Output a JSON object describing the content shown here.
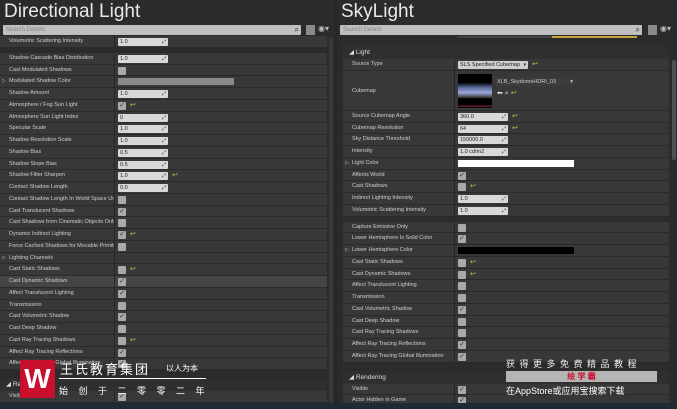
{
  "left": {
    "title": "Directional Light",
    "search_placeholder": "Search Details",
    "rows": [
      {
        "label": "Volumetric Scattering Intensity",
        "type": "number",
        "value": "1.0"
      },
      {
        "type": "gap"
      },
      {
        "label": "Shadow Cascade Bias Distribution",
        "type": "number",
        "value": "1.0"
      },
      {
        "label": "Cast Modulated Shadows",
        "type": "check",
        "checked": false
      },
      {
        "label": "Modulated Shadow Color",
        "type": "bar",
        "expand": true,
        "color": "#8a8a8a"
      },
      {
        "label": "Shadow Amount",
        "type": "number",
        "value": "1.0"
      },
      {
        "label": "Atmosphere / Fog Sun Light",
        "type": "check",
        "checked": true,
        "reset": true
      },
      {
        "label": "Atmosphere Sun Light Index",
        "type": "number",
        "value": "0"
      },
      {
        "label": "Specular Scale",
        "type": "number",
        "value": "1.0"
      },
      {
        "label": "Shadow Resolution Scale",
        "type": "number",
        "value": "1.0"
      },
      {
        "label": "Shadow Bias",
        "type": "number",
        "value": "0.5"
      },
      {
        "label": "Shadow Slope Bias",
        "type": "number",
        "value": "0.5"
      },
      {
        "label": "Shadow Filter Sharpen",
        "type": "number",
        "value": "1.0",
        "reset": true
      },
      {
        "label": "Contact Shadow Length",
        "type": "number",
        "value": "0.0"
      },
      {
        "label": "Contact Shadow Length In World Space Unit",
        "type": "check",
        "checked": false
      },
      {
        "label": "Cast Translucent Shadows",
        "type": "check",
        "checked": true
      },
      {
        "label": "Cast Shadows from Cinematic Objects Only",
        "type": "check",
        "checked": false
      },
      {
        "label": "Dynamic Indirect Lighting",
        "type": "check",
        "checked": true,
        "reset": true
      },
      {
        "label": "Force Cached Shadows for Movable Primitives",
        "type": "check",
        "checked": false
      },
      {
        "label": "Lighting Channels",
        "type": "none",
        "expand": true
      },
      {
        "label": "Cast Static Shadows",
        "type": "check",
        "checked": false,
        "reset": true
      },
      {
        "label": "Cast Dynamic Shadows",
        "type": "check",
        "checked": true,
        "highlight": true
      },
      {
        "label": "Affect Translucent Lighting",
        "type": "check",
        "checked": true
      },
      {
        "label": "Transmission",
        "type": "check",
        "checked": false
      },
      {
        "label": "Cast Volumetric Shadow",
        "type": "check",
        "checked": true
      },
      {
        "label": "Cast Deep Shadow",
        "type": "check",
        "checked": false
      },
      {
        "label": "Cast Ray Tracing Shadows",
        "type": "check",
        "checked": false,
        "reset": true
      },
      {
        "label": "Affect Ray Tracing Reflections",
        "type": "check",
        "checked": true
      },
      {
        "label": "Affect Ray Tracing Global Illumination",
        "type": "check",
        "checked": true
      },
      {
        "type": "sep"
      },
      {
        "type": "header",
        "label": "Rendering"
      },
      {
        "label": "Visible",
        "type": "check",
        "checked": true
      }
    ]
  },
  "right": {
    "title": "SkyLight",
    "search_placeholder": "Search Details",
    "rows": [
      {
        "type": "sep"
      },
      {
        "type": "header",
        "label": "Light"
      },
      {
        "label": "Source Type",
        "type": "dropdown",
        "value": "SLS Specified Cubemap",
        "reset": true
      },
      {
        "label": "Cubemap",
        "type": "asset",
        "value": "XLB_SkydomeHDRI_03"
      },
      {
        "label": "Source Cubemap Angle",
        "type": "number",
        "value": "360.0",
        "reset": true
      },
      {
        "label": "Cubemap Resolution",
        "type": "number",
        "value": "64",
        "reset": true
      },
      {
        "label": "Sky Distance Threshold",
        "type": "number",
        "value": "150000.0"
      },
      {
        "label": "Intensity",
        "type": "number",
        "value": "1.0 cd/m2"
      },
      {
        "label": "Light Color",
        "type": "bar",
        "expand": true,
        "color": "#ffffff"
      },
      {
        "label": "Affects World",
        "type": "check",
        "checked": true
      },
      {
        "label": "Cast Shadows",
        "type": "check",
        "checked": false,
        "reset": true
      },
      {
        "label": "Indirect Lighting Intensity",
        "type": "number",
        "value": "1.0"
      },
      {
        "label": "Volumetric Scattering Intensity",
        "type": "number",
        "value": "1.0"
      },
      {
        "type": "gap"
      },
      {
        "label": "Capture Emissive Only",
        "type": "check",
        "checked": false
      },
      {
        "label": "Lower Hemisphere Is Solid Color",
        "type": "check",
        "checked": true
      },
      {
        "label": "Lower Hemisphere Color",
        "type": "bar",
        "expand": true,
        "color": "#000000"
      },
      {
        "label": "Cast Static Shadows",
        "type": "check",
        "checked": false,
        "reset": true
      },
      {
        "label": "Cast Dynamic Shadows",
        "type": "check",
        "checked": false,
        "reset": true
      },
      {
        "label": "Affect Translucent Lighting",
        "type": "check",
        "checked": false
      },
      {
        "label": "Transmission",
        "type": "check",
        "checked": false
      },
      {
        "label": "Cast Volumetric Shadow",
        "type": "check",
        "checked": true
      },
      {
        "label": "Cast Deep Shadow",
        "type": "check",
        "checked": false
      },
      {
        "label": "Cast Ray Tracing Shadows",
        "type": "check",
        "checked": false
      },
      {
        "label": "Affect Ray Tracing Reflections",
        "type": "check",
        "checked": true
      },
      {
        "label": "Affect Ray Tracing Global Illumination",
        "type": "check",
        "checked": true
      },
      {
        "type": "sep"
      },
      {
        "type": "header",
        "label": "Rendering"
      },
      {
        "label": "Visible",
        "type": "check",
        "checked": true
      },
      {
        "label": "Actor Hidden in Game",
        "type": "check",
        "checked": true
      }
    ]
  },
  "watermark": {
    "company": "王氏教育集团",
    "slogan": "以人为本",
    "founded": "始 创 于 二 零 零 二 年",
    "promo": "获 得 更 多 免 费 精 品 教 程",
    "app_name": "绘 学 霸",
    "download": "在AppStore或应用宝搜索下载"
  },
  "colors": {
    "reset_arrow": "#b7c23a",
    "accent_tab": "#c8a23a",
    "logo_red": "#c8102e"
  }
}
